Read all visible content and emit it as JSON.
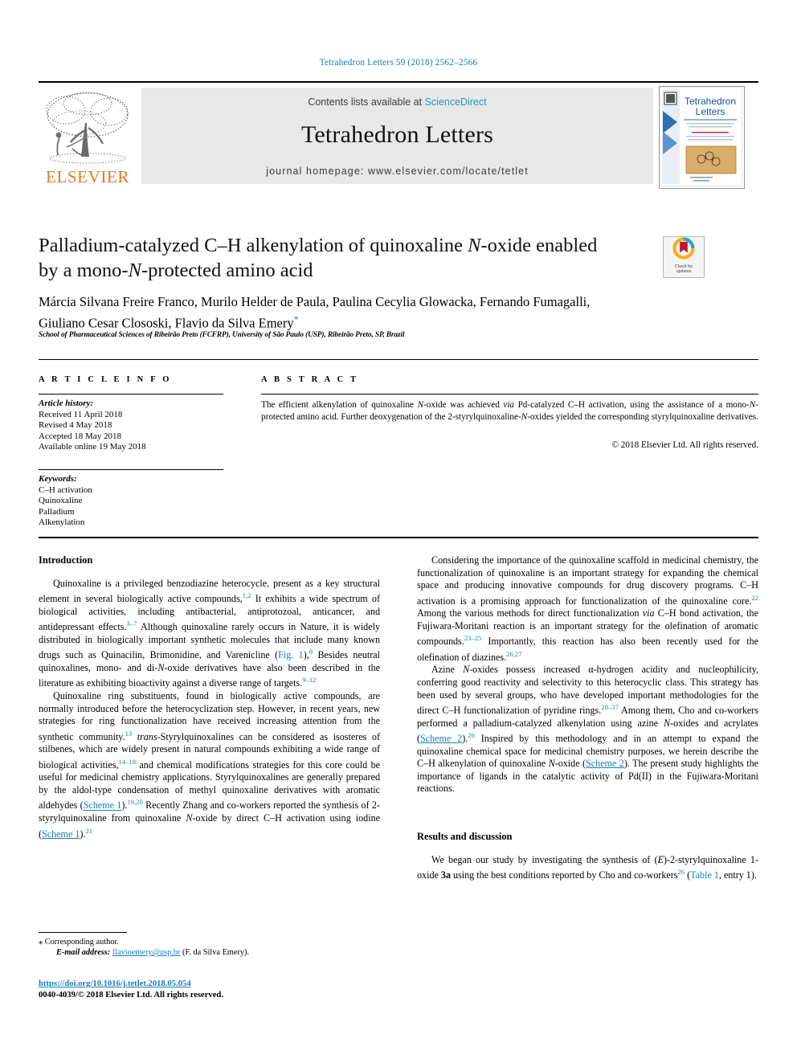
{
  "running_head": "Tetrahedron Letters 59 (2018) 2562–2566",
  "masthead": {
    "publisher": "ELSEVIER",
    "contents_prefix": "Contents lists available at ",
    "contents_link": "ScienceDirect",
    "journal_title": "Tetrahedron Letters",
    "homepage": "journal homepage: www.elsevier.com/locate/tetlet",
    "cover_title_line1": "Tetrahedron",
    "cover_title_line2": "Letters",
    "link_color": "#2196c4",
    "elsevier_orange": "#e87722"
  },
  "article": {
    "title_line1_a": "Palladium-catalyzed C–H alkenylation of quinoxaline ",
    "title_line1_italic": "N",
    "title_line1_b": "-oxide enabled",
    "title_line2_a": "by a mono-",
    "title_line2_italic": "N",
    "title_line2_b": "-protected amino acid",
    "authors_line1": "Márcia Silvana Freire Franco, Murilo Helder de Paula, Paulina Cecylia Glowacka, Fernando Fumagalli,",
    "authors_line2": "Giuliano Cesar Clososki, Flavio da Silva Emery",
    "corresponding_marker": "*",
    "affiliation": "School of Pharmaceutical Sciences of Ribeirão Preto (FCFRP), University of São Paulo (USP), Ribeirão Preto, SP, Brazil"
  },
  "crossmark": {
    "line1": "Check for",
    "line2": "updates",
    "red": "#c8102e",
    "yellow": "#f2b01e",
    "blue": "#29a3c9"
  },
  "article_info": {
    "heading": "A R T I C L E   I N F O",
    "history_label": "Article history:",
    "history": [
      "Received 11 April 2018",
      "Revised 4 May 2018",
      "Accepted 18 May 2018",
      "Available online 19 May 2018"
    ],
    "keywords_label": "Keywords:",
    "keywords": [
      "C–H activation",
      "Quinoxaline",
      "Palladium",
      "Alkenylation"
    ]
  },
  "abstract": {
    "heading": "A B S T R A C T",
    "text_1": "The efficient alkenylation of quinoxaline ",
    "it_1": "N",
    "text_2": "-oxide was achieved ",
    "it_2": "via",
    "text_3": " Pd-catalyzed C–H activation, using the assistance of a mono-",
    "it_3": "N",
    "text_4": "-protected amino acid. Further deoxygenation of the 2-styrylquinoxaline-",
    "it_4": "N",
    "text_5": "-oxides yielded the corresponding styrylquinoxaline derivatives.",
    "copyright": "© 2018 Elsevier Ltd. All rights reserved."
  },
  "sections": {
    "introduction_heading": "Introduction",
    "results_heading": "Results and discussion"
  },
  "left_column": {
    "p1": {
      "t1": "Quinoxaline is a privileged benzodiazine heterocycle, present as a key structural element in several biologically active compounds,",
      "r1": "1,2",
      "t2": " It exhibits a wide spectrum of biological activities, including antibacterial, antiprotozoal, anticancer, and antidepressant effects.",
      "r2": "3–7",
      "t3": " Although quinoxaline rarely occurs in Nature, it is widely distributed in biologically important synthetic molecules that include many known drugs such as Quinacilin, Brimonidine, and Varenicline (",
      "link1": "Fig. 1",
      "t4": "),",
      "r3": "8",
      "t5": " Besides neutral quinoxalines, mono- and di-",
      "it1": "N",
      "t6": "-oxide derivatives have also been described in the literature as exhibiting bioactivity against a diverse range of targets.",
      "r4": "9–12"
    },
    "p2": {
      "t1": "Quinoxaline ring substituents, found in biologically active compounds, are normally introduced before the heterocyclization step. However, in recent years, new strategies for ring functionalization have received increasing attention from the synthetic community.",
      "r1": "13",
      "it1": " trans",
      "t2": "-Styrylquinoxalines can be considered as isosteres of stilbenes, which are widely present in natural compounds exhibiting a wide range of biological activities,",
      "r2": "14–18",
      "t3": " and chemical modifications strategies for this core could be useful for medicinal chemistry applications. Styrylquinoxalines are generally prepared by the aldol-type condensation of methyl quinoxaline derivatives with aromatic aldehydes (",
      "link1": "Scheme 1",
      "t4": ").",
      "r3": "19,20",
      "t5": " Recently Zhang and co-workers reported the synthesis of 2-styrylquinoxaline from quinoxaline ",
      "it2": "N",
      "t6": "-oxide by direct C–H activation using iodine (",
      "link2": "Scheme 1",
      "t7": ").",
      "r4": "21"
    }
  },
  "right_column": {
    "p1": {
      "t1": "Considering the importance of the quinoxaline scaffold in medicinal chemistry, the functionalization of quinoxaline is an important strategy for expanding the chemical space and producing innovative compounds for drug discovery programs. C–H activation is a promising approach for functionalization of the quinoxaline core.",
      "r1": "22",
      "t2": " Among the various methods for direct functionalization ",
      "it1": "via",
      "t3": " C–H bond activation, the Fujiwara-Moritani reaction is an important strategy for the olefination of aromatic compounds.",
      "r2": "23–25",
      "t4": " Importantly, this reaction has also been recently used for the olefination of diazines.",
      "r3": "26,27"
    },
    "p2": {
      "t1": "Azine ",
      "it1": "N",
      "t2": "-oxides possess increased α-hydrogen acidity and nucleophilicity, conferring good reactivity and selectivity to this heterocyclic class. This strategy has been used by several groups, who have developed important methodologies for the direct C–H functionalization of pyridine rings.",
      "r1": "28–37",
      "t3": " Among them, Cho and co-workers performed a palladium-catalyzed alkenylation using azine ",
      "it2": "N",
      "t4": "-oxides and acrylates (",
      "link1": "Scheme 2",
      "t5": ").",
      "r2": "26",
      "t6": " Inspired by this methodology and in an attempt to expand the quinoxaline chemical space for medicinal chemistry purposes, we herein describe the C–H alkenylation of quinoxaline ",
      "it3": "N",
      "t7": "-oxide (",
      "link2": "Scheme 2",
      "t8": "). The present study highlights the importance of ligands in the catalytic activity of Pd(II) in the Fujiwara-Moritani reactions."
    },
    "p3": {
      "t1": "We began our study by investigating the synthesis of (",
      "it1": "E",
      "t2": ")-2-styrylquinoxaline 1-oxide ",
      "b1": "3a",
      "t3": " using the best conditions reported by Cho and co-workers",
      "r1": "26",
      "t4": " (",
      "link1": "Table 1",
      "t5": ", entry 1)."
    }
  },
  "footnote": {
    "marker": "⁎",
    "corresponding": "Corresponding author.",
    "email_label": "E-mail address:",
    "email": "flavioemery@usp.br",
    "email_suffix": " (F. da Silva Emery)."
  },
  "doi_block": {
    "doi": "https://doi.org/10.1016/j.tetlet.2018.05.054",
    "issn_line": "0040-4039/© 2018 Elsevier Ltd. All rights reserved."
  }
}
